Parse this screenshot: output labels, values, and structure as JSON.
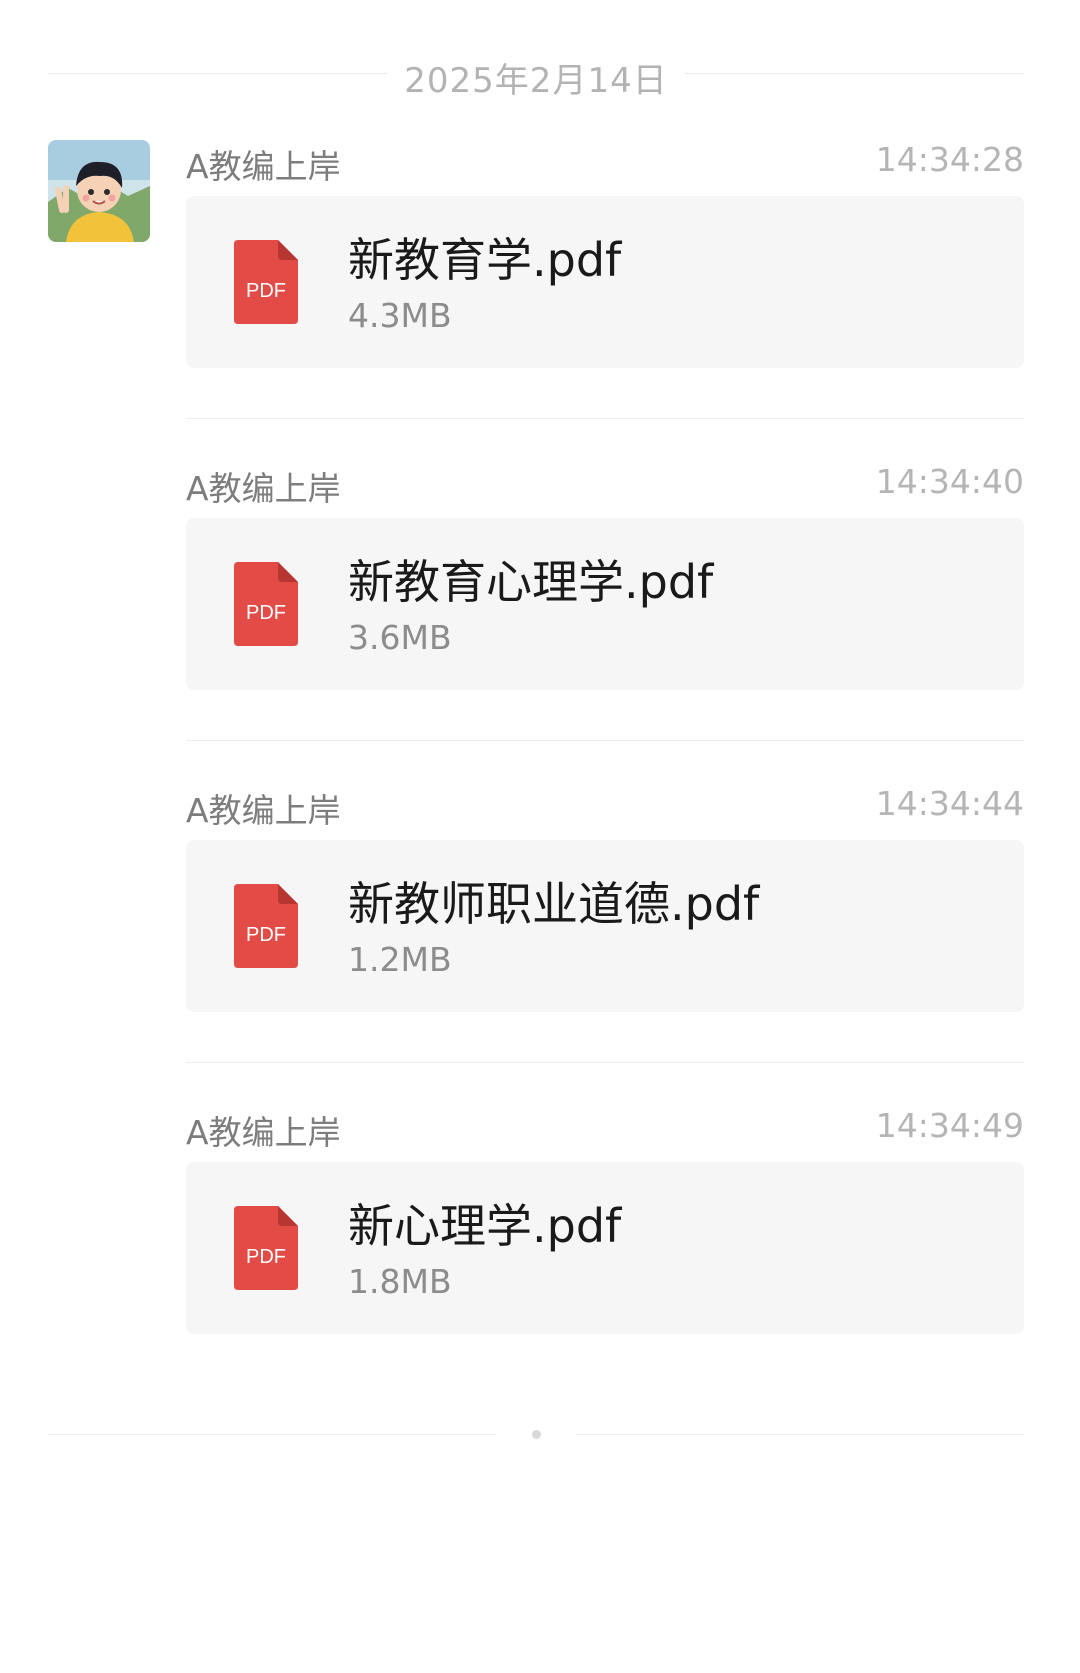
{
  "date_divider": {
    "label": "2025年2月14日"
  },
  "messages": [
    {
      "sender": "A教编上岸",
      "time": "14:34:28",
      "file": {
        "name": "新教育学.pdf",
        "size": "4.3MB",
        "type_label": "PDF"
      }
    },
    {
      "sender": "A教编上岸",
      "time": "14:34:40",
      "file": {
        "name": "新教育心理学.pdf",
        "size": "3.6MB",
        "type_label": "PDF"
      }
    },
    {
      "sender": "A教编上岸",
      "time": "14:34:44",
      "file": {
        "name": "新教师职业道德.pdf",
        "size": "1.2MB",
        "type_label": "PDF"
      }
    },
    {
      "sender": "A教编上岸",
      "time": "14:34:49",
      "file": {
        "name": "新心理学.pdf",
        "size": "1.8MB",
        "type_label": "PDF"
      }
    }
  ],
  "icons": {
    "avatar": "user-avatar",
    "file": "pdf-file-icon"
  },
  "colors": {
    "pdf_red": "#e34c46",
    "card_bg": "#f6f6f6",
    "time_gray": "#b5b5b5"
  }
}
